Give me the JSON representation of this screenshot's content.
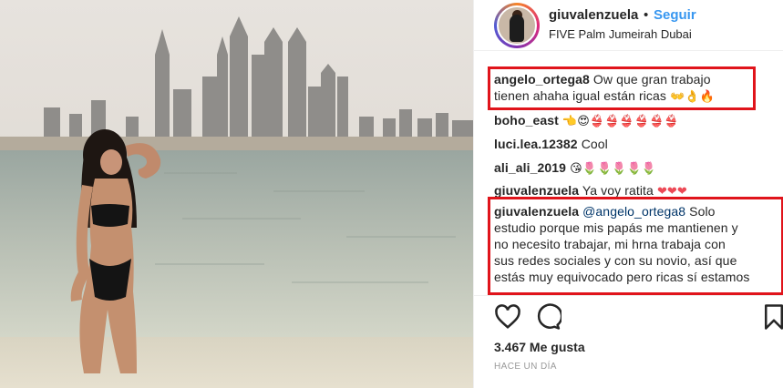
{
  "post": {
    "username": "giuvalenzuela",
    "separator": "•",
    "follow_label": "Seguir",
    "location": "FIVE Palm Jumeirah Dubai"
  },
  "comments": [
    {
      "user": "angelo_ortega8",
      "text_lines": [
        "Ow que gran trabajo",
        "tienen ahaha igual están ricas"
      ],
      "emoji": "👐👌🔥",
      "highlighted": true
    },
    {
      "user": "boho_east",
      "text_lines": [],
      "emoji": "👈😍👙👙👙👙👙👙",
      "highlighted": false
    },
    {
      "user": "luci.lea.12382",
      "text_lines": [
        "Cool"
      ],
      "emoji": "",
      "highlighted": false
    },
    {
      "user": "ali_ali_2019",
      "text_lines": [],
      "emoji": "😘🌷🌷🌷🌷🌷",
      "highlighted": false
    },
    {
      "user": "giuvalenzuela",
      "text_lines": [
        "Ya voy ratita"
      ],
      "emoji": "❤❤❤",
      "highlighted": false
    },
    {
      "user": "giuvalenzuela",
      "mention": "@angelo_ortega8",
      "text_lines": [
        "Solo",
        "estudio porque mis papás me mantienen y",
        "no necesito trabajar, mi hrna trabaja con",
        "sus redes sociales y con su novio, así que",
        "estás muy equivocado pero ricas sí estamos"
      ],
      "emoji": "",
      "highlighted": true
    }
  ],
  "actions": {
    "like_icon": "heart-outline-icon",
    "comment_icon": "speech-bubble-icon",
    "save_icon": "bookmark-icon"
  },
  "likes_text": "3.467 Me gusta",
  "timestamp": "HACE UN DÍA",
  "colors": {
    "follow": "#3897f0",
    "highlight_box": "#e0141b",
    "text": "#262626",
    "muted": "#999999"
  }
}
